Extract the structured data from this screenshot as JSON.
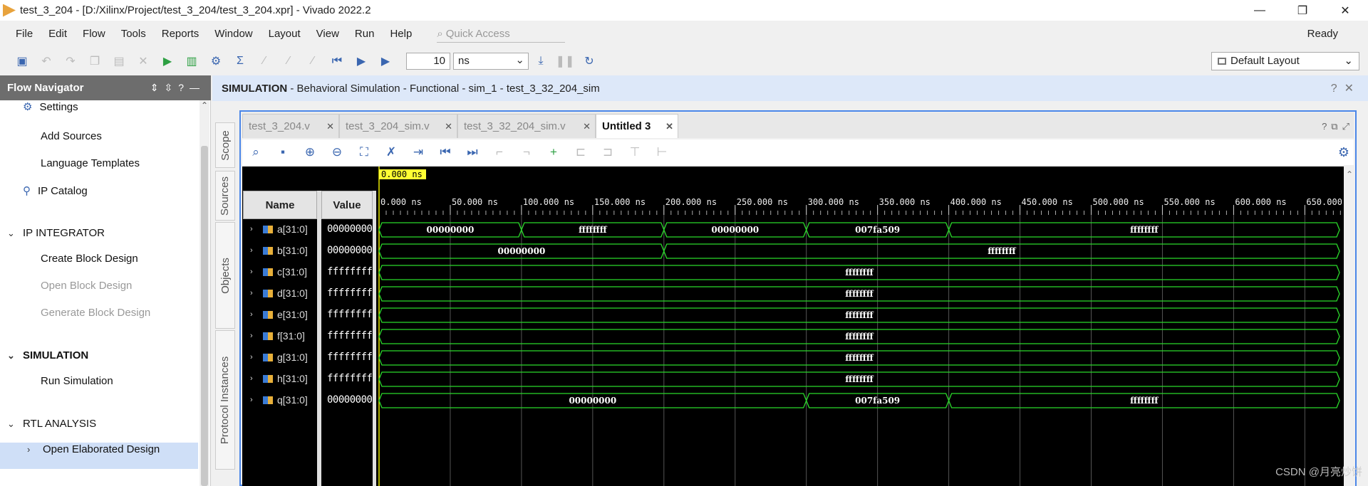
{
  "window": {
    "title": "test_3_204 - [D:/Xilinx/Project/test_3_204/test_3_204.xpr] - Vivado 2022.2",
    "minimize": "—",
    "restore": "❐",
    "close": "✕"
  },
  "menu": {
    "items": [
      "File",
      "Edit",
      "Flow",
      "Tools",
      "Reports",
      "Window",
      "Layout",
      "View",
      "Run",
      "Help"
    ],
    "quick_access": "Quick Access",
    "status": "Ready"
  },
  "toolbar": {
    "runtime_value": "10",
    "runtime_unit": "ns",
    "layout": "Default Layout"
  },
  "flow_navigator": {
    "title": "Flow Navigator",
    "items": [
      {
        "type": "sub-icon",
        "label": "Settings",
        "icon": "gear-icon"
      },
      {
        "type": "item",
        "label": "Add Sources"
      },
      {
        "type": "item",
        "label": "Language Templates"
      },
      {
        "type": "sub-icon",
        "label": "IP Catalog",
        "icon": "plug-icon"
      },
      {
        "type": "section",
        "label": "IP INTEGRATOR"
      },
      {
        "type": "item",
        "label": "Create Block Design"
      },
      {
        "type": "item-disabled",
        "label": "Open Block Design"
      },
      {
        "type": "item-disabled",
        "label": "Generate Block Design"
      },
      {
        "type": "section-selected",
        "label": "SIMULATION"
      },
      {
        "type": "item",
        "label": "Run Simulation"
      },
      {
        "type": "section",
        "label": "RTL ANALYSIS"
      },
      {
        "type": "sub-expand",
        "label": "Open Elaborated Design"
      }
    ]
  },
  "sim_header": {
    "bold": "SIMULATION",
    "rest": " - Behavioral Simulation - Functional - sim_1 - test_3_32_204_sim"
  },
  "side_tabs": [
    "Scope",
    "Sources",
    "Objects",
    "Protocol Instances"
  ],
  "tabs": [
    "test_3_204.v",
    "test_3_204_sim.v",
    "test_3_32_204_sim.v",
    "Untitled 3"
  ],
  "active_tab": 3,
  "wave": {
    "cursor_label": "0.000 ns",
    "col_name": "Name",
    "col_value": "Value",
    "time_ticks": [
      "0.000 ns",
      "50.000 ns",
      "100.000 ns",
      "150.000 ns",
      "200.000 ns",
      "250.000 ns",
      "300.000 ns",
      "350.000 ns",
      "400.000 ns",
      "450.000 ns",
      "500.000 ns",
      "550.000 ns",
      "600.000 ns",
      "650.000"
    ],
    "signals": [
      {
        "name": "a[31:0]",
        "value": "00000000",
        "segments": [
          [
            0,
            100,
            "00000000"
          ],
          [
            100,
            200,
            "ffffffff"
          ],
          [
            200,
            300,
            "00000000"
          ],
          [
            300,
            400,
            "007fa509"
          ],
          [
            400,
            680,
            "ffffffff"
          ]
        ]
      },
      {
        "name": "b[31:0]",
        "value": "00000000",
        "segments": [
          [
            0,
            200,
            "00000000"
          ],
          [
            200,
            680,
            "ffffffff"
          ]
        ]
      },
      {
        "name": "c[31:0]",
        "value": "ffffffff",
        "segments": [
          [
            0,
            680,
            "ffffffff"
          ]
        ]
      },
      {
        "name": "d[31:0]",
        "value": "ffffffff",
        "segments": [
          [
            0,
            680,
            "ffffffff"
          ]
        ]
      },
      {
        "name": "e[31:0]",
        "value": "ffffffff",
        "segments": [
          [
            0,
            680,
            "ffffffff"
          ]
        ]
      },
      {
        "name": "f[31:0]",
        "value": "ffffffff",
        "segments": [
          [
            0,
            680,
            "ffffffff"
          ]
        ]
      },
      {
        "name": "g[31:0]",
        "value": "ffffffff",
        "segments": [
          [
            0,
            680,
            "ffffffff"
          ]
        ]
      },
      {
        "name": "h[31:0]",
        "value": "ffffffff",
        "segments": [
          [
            0,
            680,
            "ffffffff"
          ]
        ]
      },
      {
        "name": "q[31:0]",
        "value": "00000000",
        "segments": [
          [
            0,
            300,
            "00000000"
          ],
          [
            300,
            400,
            "007fa509"
          ],
          [
            400,
            680,
            "ffffffff"
          ]
        ]
      }
    ]
  },
  "watermark": "CSDN @月亮炒饼"
}
